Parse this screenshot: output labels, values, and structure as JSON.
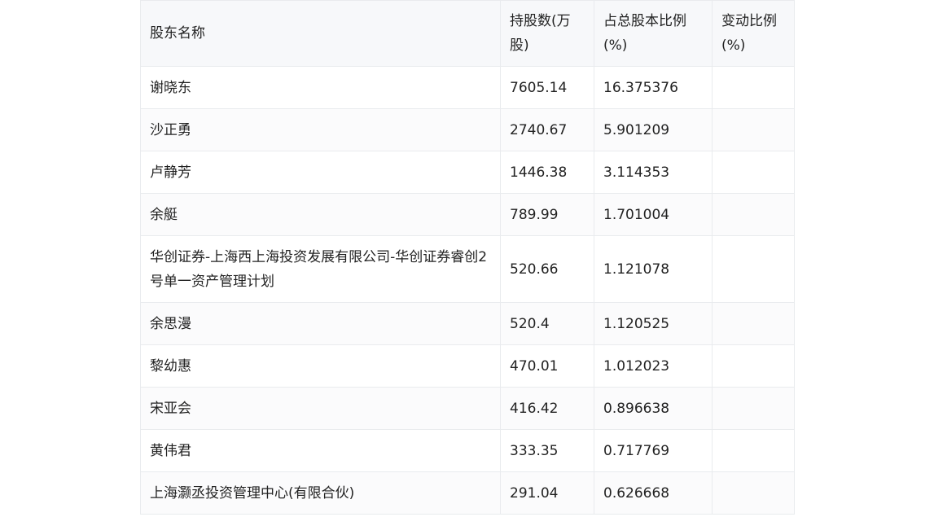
{
  "table": {
    "headers": [
      "股东名称",
      "持股数(万股)",
      "占总股本比例(%)",
      "变动比例(%)"
    ],
    "rows": [
      [
        "谢晓东",
        "7605.14",
        "16.375376",
        ""
      ],
      [
        "沙正勇",
        "2740.67",
        "5.901209",
        ""
      ],
      [
        "卢静芳",
        "1446.38",
        "3.114353",
        ""
      ],
      [
        "余艇",
        "789.99",
        "1.701004",
        ""
      ],
      [
        "华创证券-上海西上海投资发展有限公司-华创证券睿创2号单一资产管理计划",
        "520.66",
        "1.121078",
        ""
      ],
      [
        "余思漫",
        "520.4",
        "1.120525",
        ""
      ],
      [
        "黎幼惠",
        "470.01",
        "1.012023",
        ""
      ],
      [
        "宋亚会",
        "416.42",
        "0.896638",
        ""
      ],
      [
        "黄伟君",
        "333.35",
        "0.717769",
        ""
      ],
      [
        "上海灏丞投资管理中心(有限合伙)",
        "291.04",
        "0.626668",
        ""
      ]
    ]
  }
}
